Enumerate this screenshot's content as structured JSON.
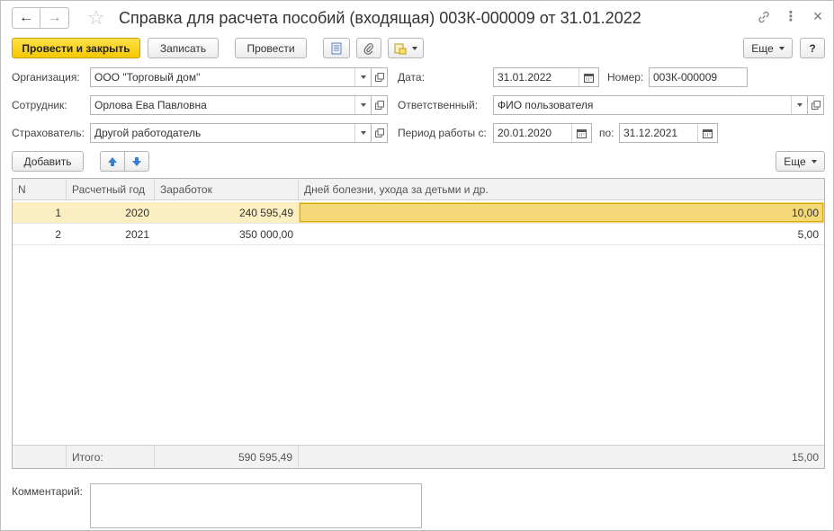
{
  "header": {
    "back_glyph": "←",
    "forward_glyph": "→",
    "star_glyph": "☆",
    "title": "Справка для расчета пособий (входящая) 003К-000009 от 31.01.2022",
    "link_glyph": "🔗",
    "more_glyph": "⋮",
    "close_glyph": "×"
  },
  "toolbar": {
    "post_close": "Провести и закрыть",
    "save": "Записать",
    "post": "Провести",
    "more": "Еще",
    "help": "?"
  },
  "form": {
    "org_label": "Организация:",
    "org_value": "ООО \"Торговый дом\"",
    "employee_label": "Сотрудник:",
    "employee_value": "Орлова Ева Павловна",
    "insurer_label": "Страхователь:",
    "insurer_value": "Другой работодатель",
    "date_label": "Дата:",
    "date_value": "31.01.2022",
    "number_label": "Номер:",
    "number_value": "003К-000009",
    "responsible_label": "Ответственный:",
    "responsible_value": "ФИО пользователя",
    "period_label": "Период работы с:",
    "period_from": "20.01.2020",
    "period_to_label": "по:",
    "period_to": "31.12.2021"
  },
  "table_toolbar": {
    "add": "Добавить",
    "more": "Еще"
  },
  "table": {
    "columns": [
      "N",
      "Расчетный год",
      "Заработок",
      "Дней болезни, ухода за детьми и др."
    ],
    "rows": [
      {
        "n": "1",
        "year": "2020",
        "earnings": "240 595,49",
        "days": "10,00"
      },
      {
        "n": "2",
        "year": "2021",
        "earnings": "350 000,00",
        "days": "5,00"
      }
    ],
    "footer": {
      "label": "Итого:",
      "earnings": "590 595,49",
      "days": "15,00"
    }
  },
  "comment": {
    "label": "Комментарий:",
    "value": ""
  },
  "colors": {
    "accent": "#f5c800",
    "selected_row": "#fbeec0",
    "selected_cell": "#f5d878"
  }
}
